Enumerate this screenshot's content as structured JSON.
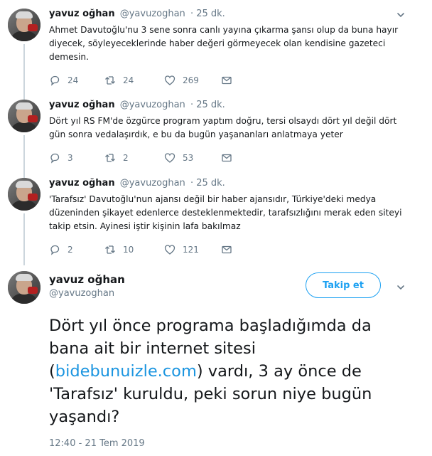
{
  "tweets": [
    {
      "name": "yavuz oğhan",
      "handle": "@yavuzoghan",
      "time": "· 25 dk.",
      "text_lines": [
        "Ahmet Davutoğlu'nu 3 sene sonra canlı yayına çıkarma şansı olup da buna hayır",
        "diyecek, söyleyeceklerinde haber değeri görmeyecek olan kendisine gazeteci",
        "demesin."
      ],
      "replies": "24",
      "retweets": "24",
      "likes": "269"
    },
    {
      "name": "yavuz oğhan",
      "handle": "@yavuzoghan",
      "time": "· 25 dk.",
      "text_lines": [
        "Dört yıl RS FM'de özgürce program yaptım doğru, tersi olsaydı dört yıl değil dört",
        "gün sonra vedalaşırdık, e bu da bugün yaşananları anlatmaya yeter"
      ],
      "replies": "3",
      "retweets": "2",
      "likes": "53"
    },
    {
      "name": "yavuz oğhan",
      "handle": "@yavuzoghan",
      "time": "· 25 dk.",
      "text_lines": [
        "'Tarafsız' Davutoğlu'nun ajansı değil bir haber ajansıdır, Türkiye'deki medya",
        "düzeninden şikayet edenlerce desteklenmektedir, tarafsızlığını merak eden siteyi",
        "takip etsin. Ayinesi iştir kişinin lafa bakılmaz"
      ],
      "replies": "2",
      "retweets": "10",
      "likes": "121"
    }
  ],
  "main_tweet": {
    "name": "yavuz oğhan",
    "handle": "@yavuzoghan",
    "follow_label": "Takip et",
    "line1": "Dört yıl önce programa başladığımda da",
    "line2": "bana ait bir internet sitesi",
    "line3_open": "(",
    "line3_link": "bidebunuizle.com",
    "line3_rest": ") vardı, 3 ay önce de",
    "line4": "'Tarafsız' kuruldu, peki sorun niye bugün",
    "line5": "yaşandı?",
    "timestamp": "12:40 - 21 Tem 2019"
  },
  "colors": {
    "accent": "#1da1f2",
    "link": "#1b95e0",
    "muted": "#657786",
    "thread_line": "#ccd6dd"
  },
  "icons": [
    "reply-icon",
    "retweet-icon",
    "like-icon",
    "message-icon",
    "chevron-down-icon"
  ]
}
